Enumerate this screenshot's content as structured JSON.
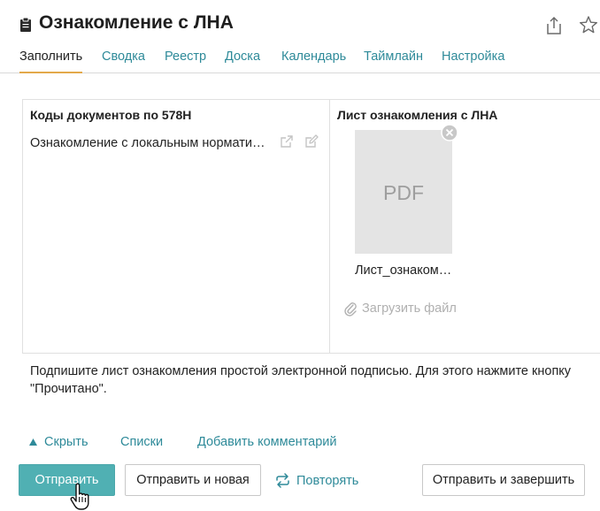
{
  "header": {
    "title": "Ознакомление с ЛНА",
    "icons": [
      "clipboard-icon",
      "share-icon",
      "star-icon"
    ]
  },
  "tabs": [
    {
      "label": "Заполнить",
      "active": true
    },
    {
      "label": "Сводка",
      "active": false
    },
    {
      "label": "Реестр",
      "active": false
    },
    {
      "label": "Доска",
      "active": false
    },
    {
      "label": "Календарь",
      "active": false
    },
    {
      "label": "Таймлайн",
      "active": false
    },
    {
      "label": "Настройка",
      "active": false
    }
  ],
  "form": {
    "left_title": "Коды документов по 578Н",
    "document_link": "Ознакомление с локальным нормативным актом",
    "right_title": "Лист ознакомления с ЛНА",
    "file_thumb_label": "PDF",
    "file_name": "Лист_ознакомления.pdf",
    "upload_label": "Загрузить файл",
    "hint": "Подпишите лист ознакомления простой электронной подписью. Для этого нажмите кнопку \"Прочитано\"."
  },
  "links": {
    "collapse": "Скрыть",
    "lists": "Списки",
    "add_comment": "Добавить комментарий"
  },
  "actions": {
    "submit": "Отправить",
    "submit_new": "Отправить и новая",
    "repeat": "Повторять",
    "submit_finish": "Отправить и завершить"
  },
  "colors": {
    "accent": "#2e8a99",
    "primary_button": "#50b0b3",
    "active_tab_underline": "#e3a94a",
    "thumb_background": "#e4e4e4"
  }
}
